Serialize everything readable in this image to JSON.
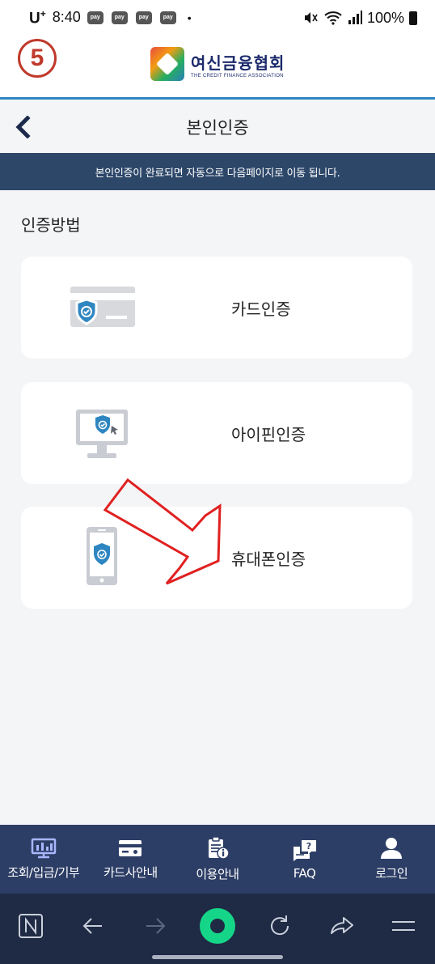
{
  "status_bar": {
    "carrier": "U",
    "carrier_sup": "+",
    "time": "8:40",
    "pay_icons": [
      "pay",
      "pay",
      "pay",
      "pay"
    ],
    "dot": "•",
    "battery": "100%",
    "icons": [
      "mute-icon",
      "wifi-icon",
      "signal-icon",
      "battery-icon"
    ]
  },
  "header": {
    "step_marker": "5",
    "logo_kor": "여신금융협회",
    "logo_eng": "THE CREDIT FINANCE ASSOCIATION"
  },
  "title_bar": {
    "title": "본인인증"
  },
  "notice": "본인인증이 완료되면 자동으로 다음페이지로 이동 됩니다.",
  "section_label": "인증방법",
  "auth_methods": [
    {
      "label": "카드인증",
      "icon": "credit-card-shield-icon"
    },
    {
      "label": "아이핀인증",
      "icon": "monitor-shield-icon"
    },
    {
      "label": "휴대폰인증",
      "icon": "mobile-shield-icon"
    }
  ],
  "bottom_nav": [
    {
      "label": "조회/입금/기부",
      "icon": "presentation-icon",
      "active": true
    },
    {
      "label": "카드사안내",
      "icon": "card-icon"
    },
    {
      "label": "이용안내",
      "icon": "clipboard-info-icon"
    },
    {
      "label": "FAQ",
      "icon": "faq-icon"
    },
    {
      "label": "로그인",
      "icon": "person-icon"
    }
  ],
  "browser_bar": [
    "n-home-icon",
    "back-arrow-icon",
    "forward-arrow-icon",
    "home-circle-icon",
    "refresh-icon",
    "share-icon",
    "menu-icon"
  ],
  "colors": {
    "accent_blue": "#2e86c1",
    "notice_bg": "#2d4769",
    "nav_bg": "#2d3e66",
    "browser_bg": "#1f2a44",
    "annotation_red": "#e02020",
    "shield_blue": "#2e86c1"
  }
}
